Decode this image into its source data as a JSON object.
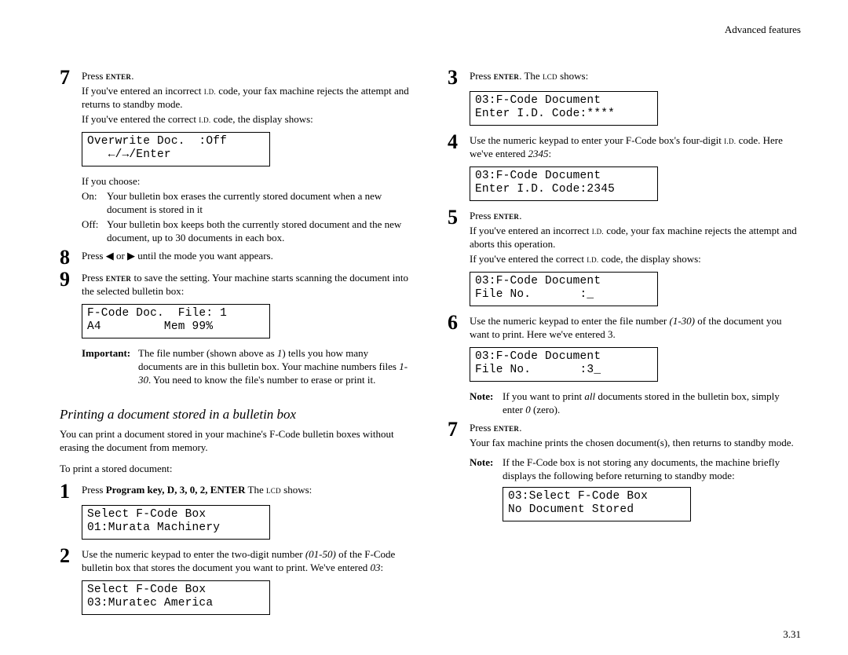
{
  "header": "Advanced features",
  "page_number": "3.31",
  "left": {
    "s7": {
      "num": "7",
      "l1_a": "Press ",
      "l1_b": "ENTER",
      "l1_c": ".",
      "l2_a": "If you've entered an incorrect ",
      "l2_b": "I.D.",
      "l2_c": " code, your fax machine rejects the attempt and returns to standby mode.",
      "l3_a": "If you've entered the correct ",
      "l3_b": "I.D.",
      "l3_c": " code, the display shows:",
      "lcd1": "Overwrite Doc.  :Off",
      "lcd2": "   ←/→/Enter",
      "choose": "If you choose:",
      "on_lab": "On:",
      "on_txt": "Your bulletin box erases the currently stored document when a new document is stored in it",
      "off_lab": "Off:",
      "off_txt": "Your bulletin box keeps both the currently stored document and the new document, up to 30 documents in each box."
    },
    "s8": {
      "num": "8",
      "t": "Press  ◀  or  ▶  until the mode you want appears."
    },
    "s9": {
      "num": "9",
      "t_a": "Press ",
      "t_b": "ENTER",
      "t_c": " to save the setting. Your machine starts scanning the document into the selected bulletin box:",
      "lcd1": "F-Code Doc.  File: 1",
      "lcd2": "A4         Mem 99%",
      "imp_lab": "Important:",
      "imp_txt_a": "The file number (shown above as ",
      "imp_txt_b": "1",
      "imp_txt_c": ") tells you how many documents are in this bulletin box. Your machine numbers files ",
      "imp_txt_d": "1-30",
      "imp_txt_e": ". You need to know the file's number to erase or print it."
    },
    "section_title": "Printing a document stored in a bulletin box",
    "intro": "You can print a document stored in your machine's F-Code bulletin boxes without erasing the document from memory.",
    "intro2": "To print a stored document:",
    "p1": {
      "num": "1",
      "t_a": "Press ",
      "t_b": "Program key, D, 3, 0, 2, ENTER",
      "t_c": " The ",
      "t_d": "LCD",
      "t_e": " shows:",
      "lcd1": "Select F-Code Box",
      "lcd2": "01:Murata Machinery"
    },
    "p2": {
      "num": "2",
      "t_a": "Use the numeric keypad to enter the two-digit number ",
      "t_b": "(01-50)",
      "t_c": " of the F-Code bulletin box that stores the document you want to print. We've entered ",
      "t_d": "03",
      "t_e": ":",
      "lcd1": "Select F-Code Box",
      "lcd2": "03:Muratec America"
    }
  },
  "right": {
    "s3": {
      "num": "3",
      "t_a": "Press ",
      "t_b": "ENTER",
      "t_c": ". The ",
      "t_d": "LCD",
      "t_e": " shows:",
      "lcd1": "03:F-Code Document",
      "lcd2": "Enter I.D. Code:****"
    },
    "s4": {
      "num": "4",
      "t_a": "Use the numeric keypad to enter your F-Code box's four-digit ",
      "t_b": "I.D.",
      "t_c": " code. Here we've entered ",
      "t_d": "2345",
      "t_e": ":",
      "lcd1": "03:F-Code Document",
      "lcd2": "Enter I.D. Code:2345"
    },
    "s5": {
      "num": "5",
      "t_a": "Press ",
      "t_b": "ENTER",
      "t_c": ".",
      "l2_a": "If you've entered an incorrect ",
      "l2_b": "I.D.",
      "l2_c": " code, your fax machine rejects the attempt and aborts this operation.",
      "l3_a": "If you've entered the correct ",
      "l3_b": "I.D.",
      "l3_c": " code, the display shows:",
      "lcd1": "03:F-Code Document",
      "lcd2": "File No.       :_"
    },
    "s6": {
      "num": "6",
      "t_a": "Use the numeric keypad to enter the file number ",
      "t_b": "(1-30)",
      "t_c": " of the document you want to print. Here we've entered 3.",
      "lcd1": "03:F-Code Document",
      "lcd2": "File No.       :3_",
      "note_lab": "Note:",
      "note_a": "If you want to print ",
      "note_b": "all",
      "note_c": " documents stored in the bulletin box, simply enter ",
      "note_d": "0",
      "note_e": " (zero)."
    },
    "s7": {
      "num": "7",
      "t_a": "Press ",
      "t_b": "ENTER",
      "t_c": ".",
      "l2": "Your fax machine prints the chosen document(s), then returns to standby mode.",
      "note_lab": "Note:",
      "note_txt": "If the F-Code box is not storing any documents, the machine briefly displays the following before returning to standby mode:",
      "lcd1": "03:Select F-Code Box",
      "lcd2": "No Document Stored"
    }
  }
}
